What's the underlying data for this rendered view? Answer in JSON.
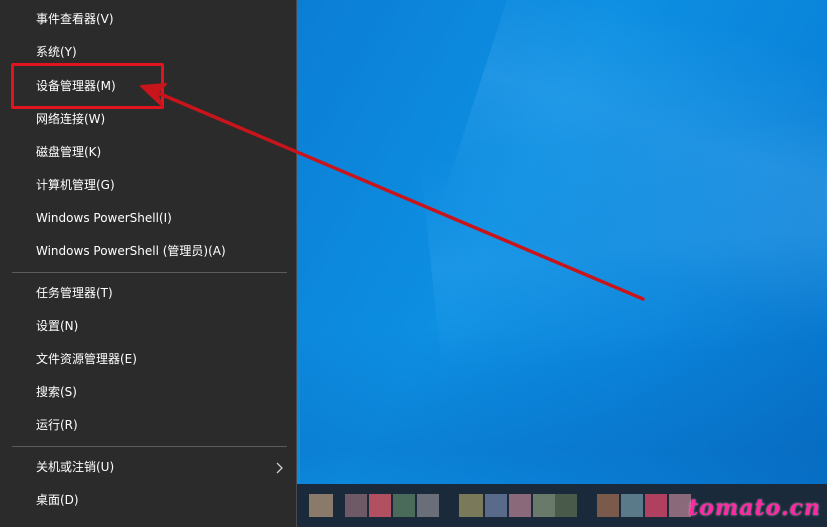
{
  "menu": {
    "items": [
      {
        "label": "事件查看器(V)"
      },
      {
        "label": "系统(Y)"
      },
      {
        "label": "设备管理器(M)"
      },
      {
        "label": "网络连接(W)"
      },
      {
        "label": "磁盘管理(K)"
      },
      {
        "label": "计算机管理(G)"
      },
      {
        "label": "Windows PowerShell(I)"
      },
      {
        "label": "Windows PowerShell (管理员)(A)"
      },
      {
        "label": "任务管理器(T)"
      },
      {
        "label": "设置(N)"
      },
      {
        "label": "文件资源管理器(E)"
      },
      {
        "label": "搜索(S)"
      },
      {
        "label": "运行(R)"
      },
      {
        "label": "关机或注销(U)"
      },
      {
        "label": "桌面(D)"
      }
    ]
  },
  "watermark": {
    "text": "tomato.cn"
  },
  "colors": {
    "menu_bg": "#2b2b2b",
    "menu_text": "#ffffff",
    "separator": "#5c5c5c",
    "annotation_red": "#e0141e",
    "desktop_blue": "#0b80d6",
    "watermark": "#ff2aa3"
  },
  "icons": {
    "submenu": "chevron-right-icon"
  }
}
